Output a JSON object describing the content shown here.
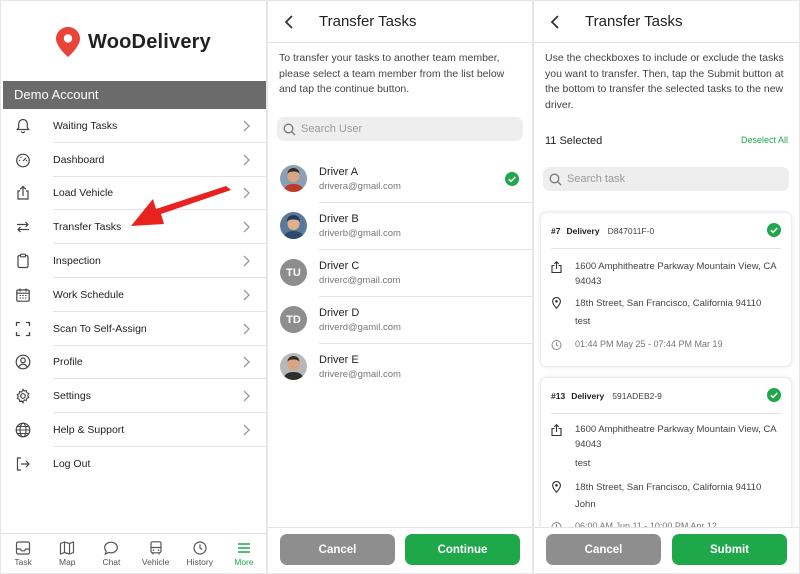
{
  "menu_screen": {
    "app_name": "WooDelivery",
    "account": "Demo Account",
    "items": [
      {
        "label": "Waiting Tasks",
        "icon": "bell-icon"
      },
      {
        "label": "Dashboard",
        "icon": "gauge-icon"
      },
      {
        "label": "Load Vehicle",
        "icon": "upload-icon"
      },
      {
        "label": "Transfer Tasks",
        "icon": "transfer-icon"
      },
      {
        "label": "Inspection",
        "icon": "clipboard-icon"
      },
      {
        "label": "Work Schedule",
        "icon": "calendar-icon"
      },
      {
        "label": "Scan To Self-Assign",
        "icon": "scan-icon"
      },
      {
        "label": "Profile",
        "icon": "user-circle-icon"
      },
      {
        "label": "Settings",
        "icon": "gear-icon"
      },
      {
        "label": "Help & Support",
        "icon": "globe-icon"
      },
      {
        "label": "Log Out",
        "icon": "logout-icon"
      }
    ],
    "nav": [
      {
        "label": "Task",
        "icon": "inbox-icon"
      },
      {
        "label": "Map",
        "icon": "map-icon"
      },
      {
        "label": "Chat",
        "icon": "chat-icon"
      },
      {
        "label": "Vehicle",
        "icon": "bus-icon"
      },
      {
        "label": "History",
        "icon": "clock-icon"
      },
      {
        "label": "More",
        "icon": "menu-icon",
        "active": true
      }
    ]
  },
  "select_screen": {
    "title": "Transfer Tasks",
    "instructions": "To transfer your tasks to another team member, please select a team member from the list below and tap the continue button.",
    "search_placeholder": "Search User",
    "drivers": [
      {
        "name": "Driver A",
        "email": "drivera@gmail.com",
        "avatar": "photo",
        "selected": true
      },
      {
        "name": "Driver B",
        "email": "driverb@gmail.com",
        "avatar": "photo",
        "selected": false
      },
      {
        "name": "Driver C",
        "email": "driverc@gmail.com",
        "avatar": "TU",
        "selected": false
      },
      {
        "name": "Driver D",
        "email": "driverd@gamil.com",
        "avatar": "TD",
        "selected": false
      },
      {
        "name": "Driver E",
        "email": "drivere@gmail.com",
        "avatar": "photo",
        "selected": false
      }
    ],
    "cancel_label": "Cancel",
    "continue_label": "Continue"
  },
  "tasks_screen": {
    "title": "Transfer Tasks",
    "instructions": "Use the checkboxes to include or exclude the tasks you want to transfer. Then, tap the Submit button at the bottom to transfer the selected tasks to the new driver.",
    "selected_count": "11 Selected",
    "deselect_label": "Deselect All",
    "search_placeholder": "Search task",
    "cards": [
      {
        "number": "#7",
        "type": "Delivery",
        "code": "D847011F-0",
        "pickup": "1600 Amphitheatre Parkway Mountain View, CA 94043",
        "dropoff": "18th Street, San Francisco, California 94110",
        "note": "test",
        "time": "01:44 PM May 25 - 07:44 PM Mar 19"
      },
      {
        "number": "#13",
        "type": "Delivery",
        "code": "591ADEB2-9",
        "pickup": "1600 Amphitheatre Parkway Mountain View, CA 94043",
        "pickup_note": "test",
        "dropoff": "18th Street, San Francisco, California 94110",
        "dropoff_note": "John",
        "time": "06:00 AM Jun 11 - 10:00 PM Apr 12"
      }
    ],
    "cancel_label": "Cancel",
    "submit_label": "Submit"
  },
  "colors": {
    "accent": "#1fa84a",
    "account_bar": "#6b6b6b",
    "logo_pin": "#e8443a",
    "arrow": "#e8231f"
  }
}
